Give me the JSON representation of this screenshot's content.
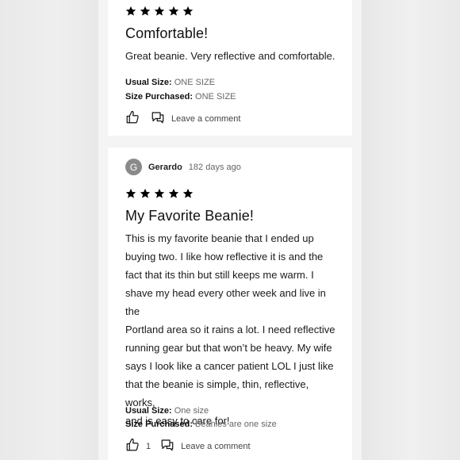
{
  "review1": {
    "rating": 5,
    "title": "Comfortable!",
    "body": "Great beanie. Very reflective and comfortable.",
    "usual_size_label": "Usual Size:",
    "usual_size_value": "ONE SIZE",
    "size_purchased_label": "Size Purchased:",
    "size_purchased_value": "ONE SIZE",
    "comment_label": "Leave a comment"
  },
  "review2": {
    "avatar_initial": "G",
    "author": "Gerardo",
    "date": "182 days ago",
    "rating": 5,
    "title": "My Favorite Beanie!",
    "body_lines": [
      "This is my favorite beanie that I ended up",
      "buying two. I like how reflective it is and the",
      "fact that its thin but still keeps me warm. I",
      "shave my head every other week and live in the",
      "Portland area so it rains a lot. I need reflective",
      "running gear but that won’t be heavy. My wife",
      "says I look like a cancer patient LOL I just like",
      "that the beanie is simple, thin, reflective, works,",
      "and is easy to care for!"
    ],
    "usual_size_label": "Usual Size:",
    "usual_size_value": "One size",
    "size_purchased_label": "Size Purchased:",
    "size_purchased_value": "Beanies are one size",
    "like_count": "1",
    "comment_label": "Leave a comment"
  }
}
